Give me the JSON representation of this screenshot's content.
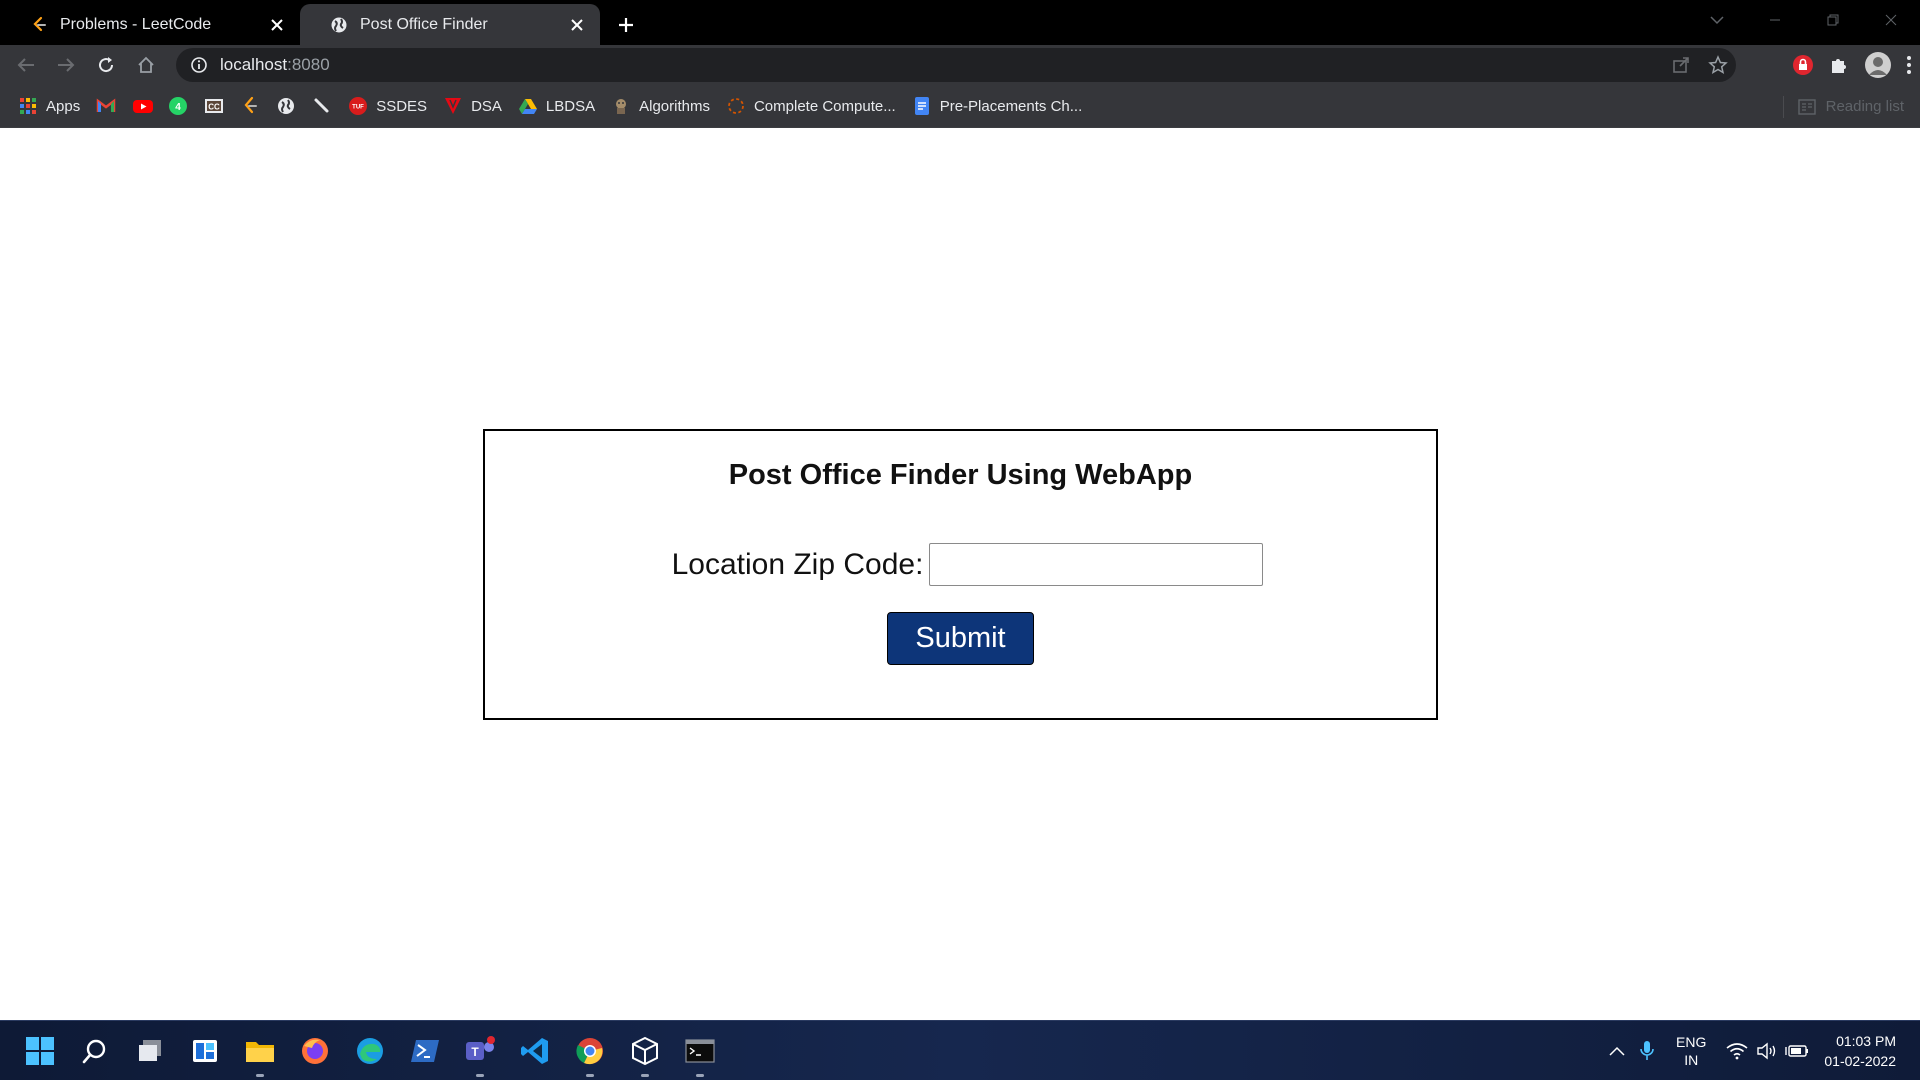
{
  "tabs": [
    {
      "title": "Problems - LeetCode",
      "favicon": "leetcode-icon",
      "active": false
    },
    {
      "title": "Post Office Finder",
      "favicon": "globe-icon",
      "active": true
    }
  ],
  "address_bar": {
    "host": "localhost",
    "port": ":8080"
  },
  "bookmarks": [
    {
      "label": "Apps",
      "icon": "apps-grid-icon"
    },
    {
      "label": "",
      "icon": "gmail-icon"
    },
    {
      "label": "",
      "icon": "youtube-icon"
    },
    {
      "label": "",
      "icon": "whatsapp-icon"
    },
    {
      "label": "",
      "icon": "cc-icon"
    },
    {
      "label": "",
      "icon": "leetcode-icon"
    },
    {
      "label": "",
      "icon": "globe-icon"
    },
    {
      "label": "",
      "icon": "pen-icon"
    },
    {
      "label": "SSDES",
      "icon": "tuf-icon"
    },
    {
      "label": "DSA",
      "icon": "dsa-icon"
    },
    {
      "label": "LBDSA",
      "icon": "drive-icon"
    },
    {
      "label": "Algorithms",
      "icon": "algorithms-icon"
    },
    {
      "label": "Complete Compute...",
      "icon": "loading-icon"
    },
    {
      "label": "Pre-Placements Ch...",
      "icon": "docs-icon"
    }
  ],
  "reading_list": "Reading list",
  "page": {
    "heading": "Post Office Finder Using WebApp",
    "zip_label": "Location Zip Code:",
    "zip_value": "",
    "submit_label": "Submit"
  },
  "taskbar": {
    "lang_top": "ENG",
    "lang_bottom": "IN",
    "time": "01:03 PM",
    "date": "01-02-2022"
  },
  "colors": {
    "submit_bg": "#0d3579",
    "chrome_dark": "#35363a",
    "tab_strip": "#000000"
  }
}
